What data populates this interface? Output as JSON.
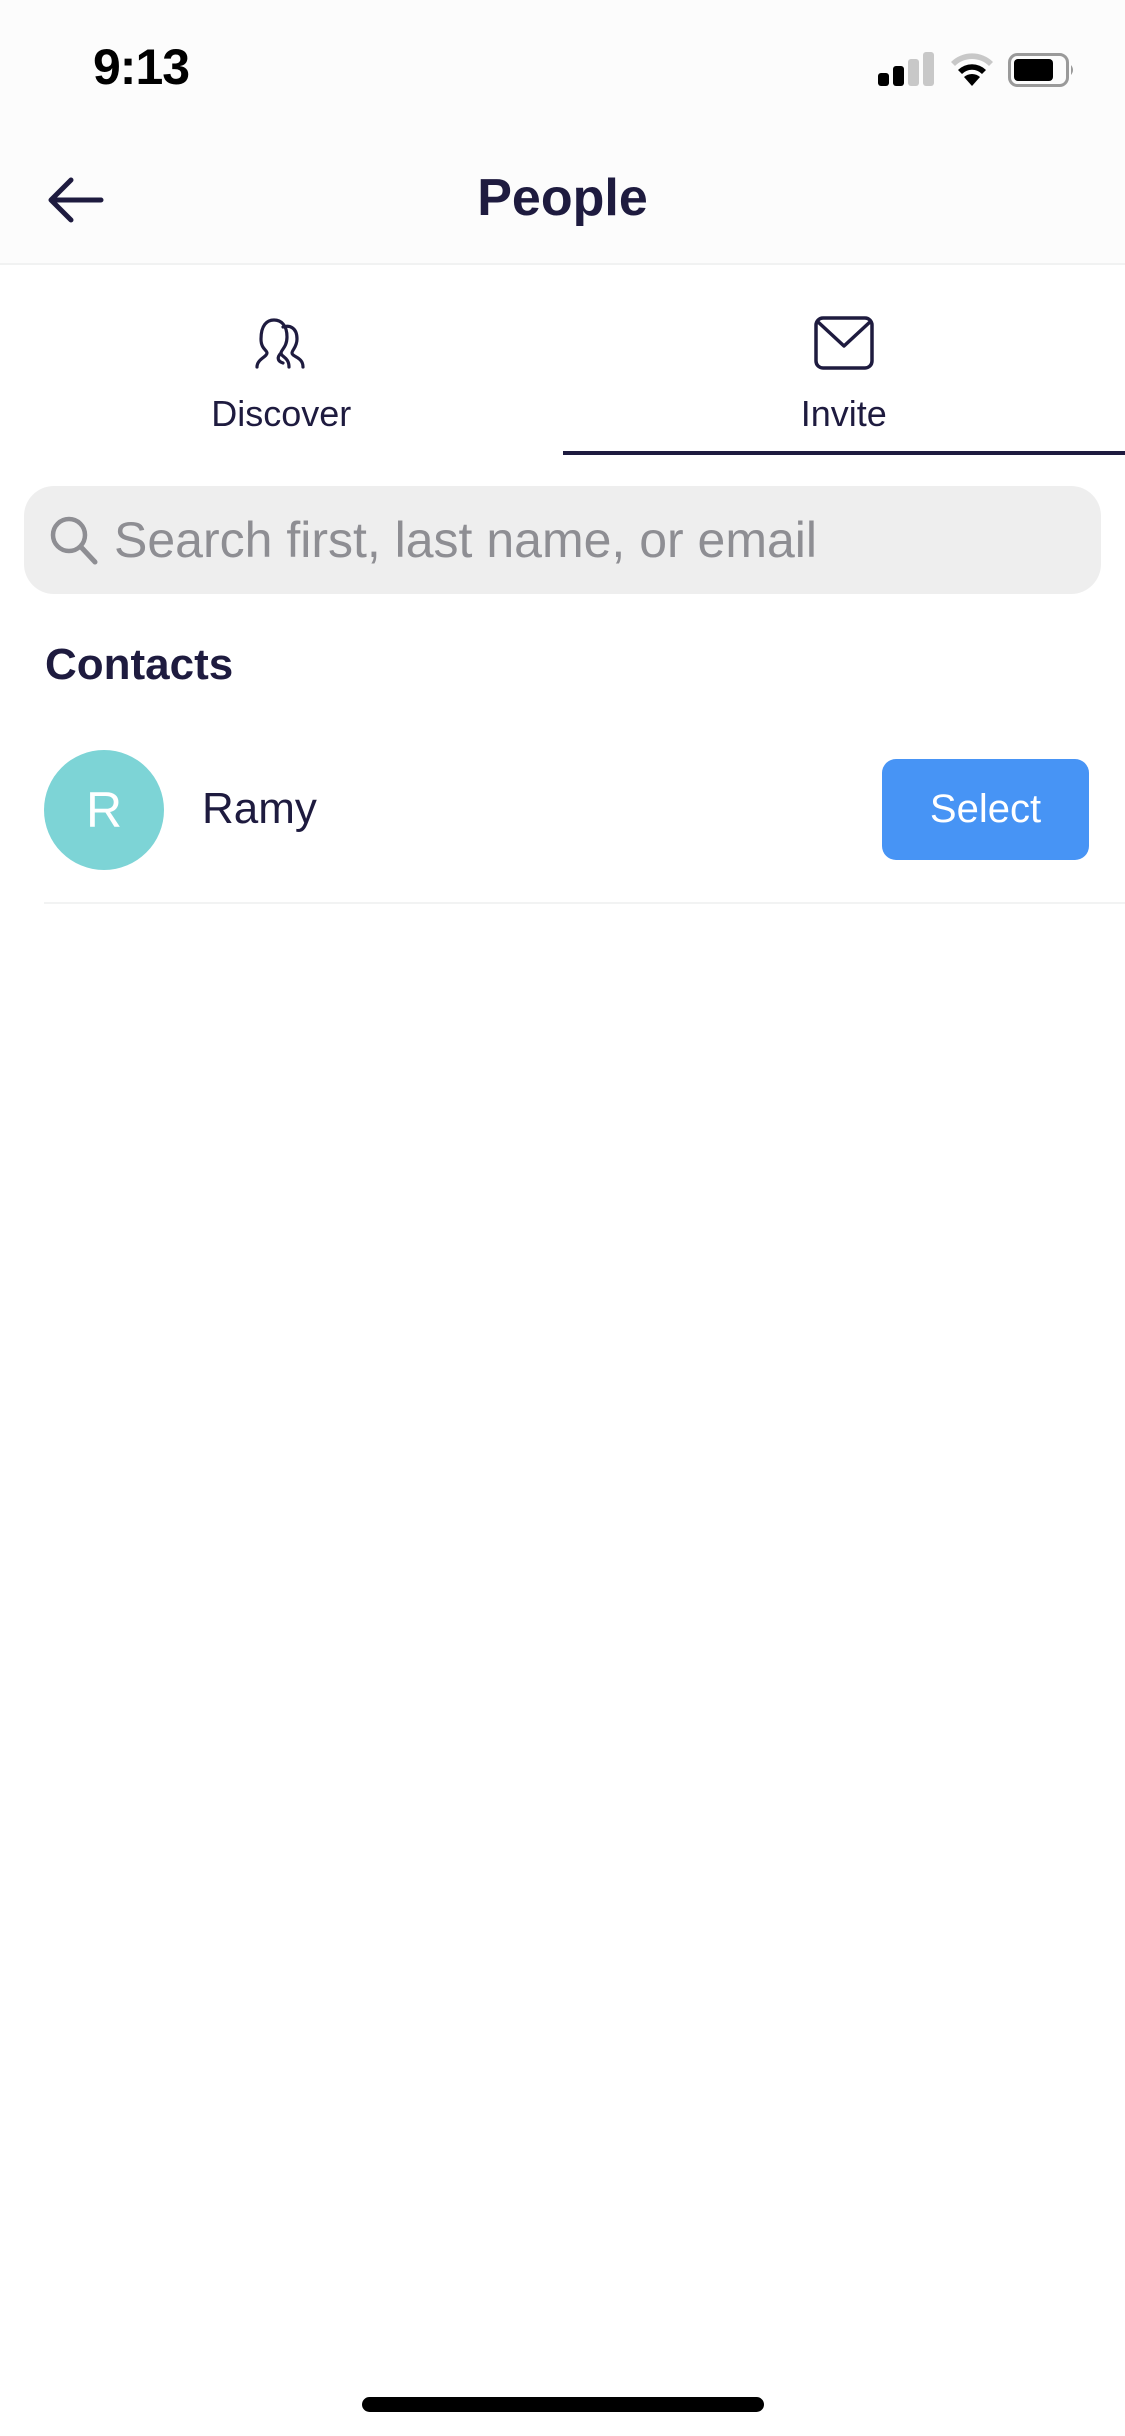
{
  "status_bar": {
    "time": "9:13",
    "signal_bars_active": 2,
    "signal_bars_total": 4,
    "wifi_icon": "wifi-icon",
    "battery_icon": "battery-icon",
    "battery_level": 0.75
  },
  "header": {
    "back_icon": "arrow-left-icon",
    "title": "People"
  },
  "tabs": [
    {
      "label": "Discover",
      "icon": "people-icon",
      "active": false
    },
    {
      "label": "Invite",
      "icon": "envelope-icon",
      "active": true
    }
  ],
  "search": {
    "icon": "search-icon",
    "placeholder": "Search first, last name, or email",
    "value": ""
  },
  "contacts": {
    "section_title": "Contacts",
    "items": [
      {
        "initial": "R",
        "name": "Ramy",
        "action_label": "Select",
        "avatar_color": "#7DD4D6"
      }
    ]
  },
  "colors": {
    "primary_text": "#1E1B3F",
    "accent_button": "#4794F5",
    "search_bg": "#EEEEEE",
    "placeholder": "#8E8E93"
  }
}
